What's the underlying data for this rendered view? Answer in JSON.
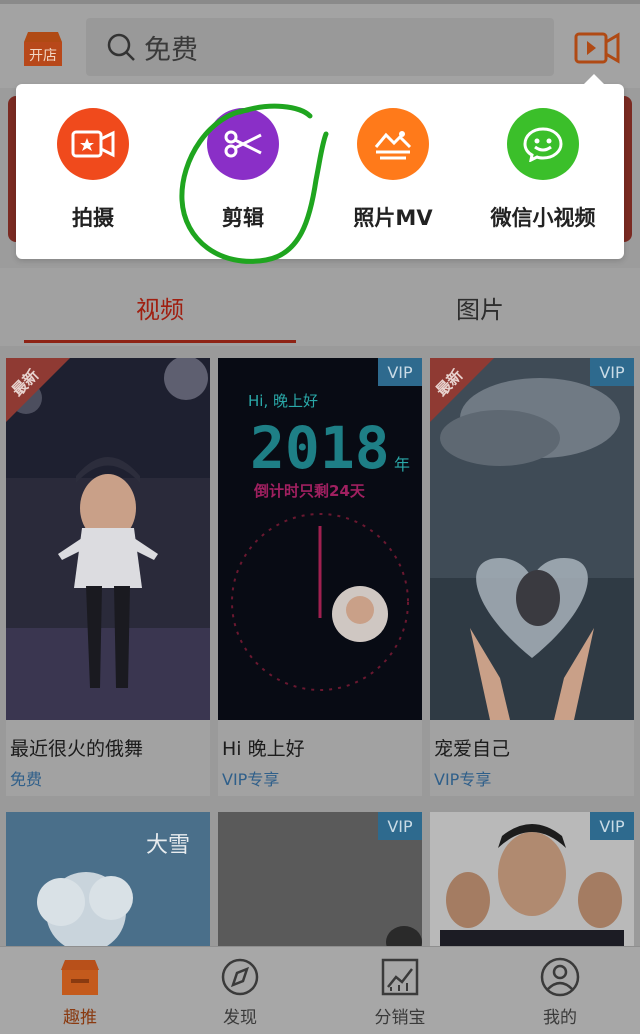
{
  "colors": {
    "accent": "#ff6a1a",
    "vip": "#2e6a8e",
    "annotation": "#1fa51f"
  },
  "header": {
    "shop_label": "开店",
    "search_placeholder": "免费",
    "camera_icon": "video-camera-icon"
  },
  "popup": {
    "items": [
      {
        "label": "拍摄",
        "icon": "video-star-icon",
        "color": "#f04a1c"
      },
      {
        "label": "剪辑",
        "icon": "scissors-icon",
        "color": "#8a2fc7"
      },
      {
        "label": "照片MV",
        "icon": "landscape-photo-icon",
        "color": "#ff7a1a"
      },
      {
        "label": "微信小视频",
        "icon": "wechat-icon",
        "color": "#3bbf2a"
      }
    ]
  },
  "tabs": [
    {
      "label": "视频",
      "active": true
    },
    {
      "label": "图片",
      "active": false
    }
  ],
  "cards": [
    {
      "title": "最近很火的俄舞",
      "tag": "免费",
      "badge": "最新",
      "vip": ""
    },
    {
      "title": "Hi 晚上好",
      "tag": "VIP专享",
      "badge": "",
      "vip": "VIP",
      "thumb_text": {
        "greeting": "Hi, 晚上好",
        "year": "2018",
        "year_suffix": "年",
        "countdown": "倒计时只剩24天"
      }
    },
    {
      "title": "宠爱自己",
      "tag": "VIP专享",
      "badge": "最新",
      "vip": "VIP"
    },
    {
      "title": "",
      "tag": "",
      "badge": "",
      "vip": "",
      "thumb_text": {
        "snow": "大雪"
      }
    },
    {
      "title": "",
      "tag": "",
      "badge": "",
      "vip": "VIP"
    },
    {
      "title": "",
      "tag": "",
      "badge": "",
      "vip": "VIP"
    }
  ],
  "bottom_nav": [
    {
      "label": "趣推",
      "icon": "shop-icon",
      "active": true
    },
    {
      "label": "发现",
      "icon": "compass-icon",
      "active": false
    },
    {
      "label": "分销宝",
      "icon": "chart-icon",
      "active": false
    },
    {
      "label": "我的",
      "icon": "user-icon",
      "active": false
    }
  ]
}
